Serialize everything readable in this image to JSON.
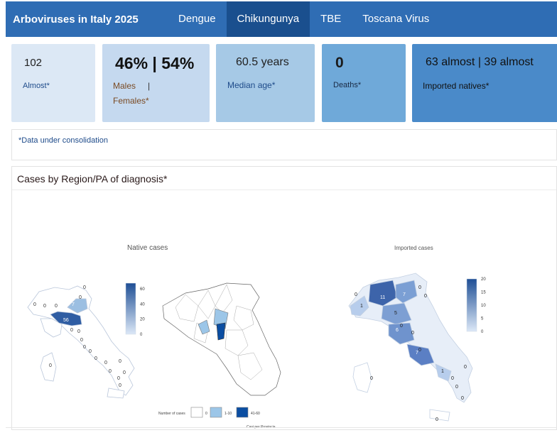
{
  "header": {
    "title": "Arboviruses in Italy 2025",
    "tabs": [
      {
        "label": "Dengue",
        "active": false
      },
      {
        "label": "Chikungunya",
        "active": true
      },
      {
        "label": "TBE",
        "active": false
      },
      {
        "label": "Toscana Virus",
        "active": false
      }
    ]
  },
  "kpis": {
    "cases": {
      "value": "102",
      "label": "Almost*"
    },
    "sex": {
      "value": "46% | 54%",
      "label_males": "Males",
      "sep": "|",
      "label_females": "Females*"
    },
    "age": {
      "value": "60.5 years",
      "label": "Median age*"
    },
    "deaths": {
      "value": "0",
      "label": "Deaths*"
    },
    "origin": {
      "value": "63 almost | 39 almost",
      "label": "Imported natives*"
    }
  },
  "note": "*Data under consolidation",
  "panel": {
    "title": "Cases by Region/PA of diagnosis*",
    "native": {
      "title": "Native cases",
      "legend_ticks": [
        "60",
        "40",
        "20",
        "0"
      ],
      "region_labels": [
        "0",
        "0",
        "0",
        "7",
        "0",
        "0",
        "56",
        "0",
        "0",
        "0",
        "0",
        "0",
        "0",
        "0",
        "0",
        "0",
        "0",
        "0",
        "0",
        "0"
      ],
      "province_legend": {
        "title": "Number of cases",
        "bins": [
          "0",
          "1-10",
          "41-60"
        ],
        "caption": "Casi per Provincia"
      }
    },
    "imported": {
      "title": "Imported cases",
      "legend_ticks": [
        "20",
        "15",
        "10",
        "5",
        "0"
      ],
      "region_labels": [
        "0",
        "11",
        "7",
        "0",
        "0",
        "1",
        "5",
        "0",
        "6",
        "0",
        "0",
        "7",
        "1",
        "0",
        "0",
        "0",
        "0",
        "0",
        "0"
      ]
    }
  },
  "colors": {
    "header_bg": "#2f6db4",
    "tab_active": "#1a4f8e",
    "scale_low": "#dce8f7",
    "scale_high": "#1f4f95"
  }
}
